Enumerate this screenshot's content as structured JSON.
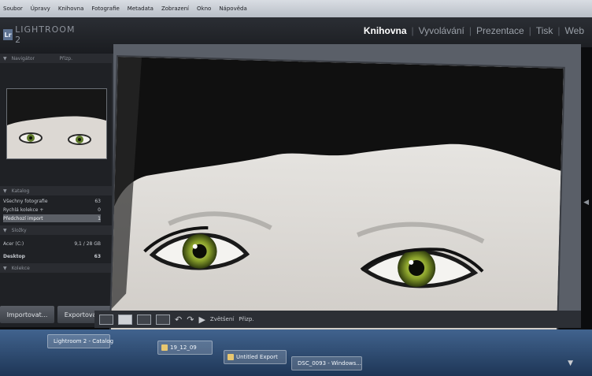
{
  "os_menu": [
    "Soubor",
    "Úpravy",
    "Knihovna",
    "Fotografie",
    "Metadata",
    "Zobrazení",
    "Okno",
    "Nápověda"
  ],
  "app": {
    "logo_abbrev": "Lr",
    "logo_name": "LIGHTROOM 2"
  },
  "modules": {
    "items": [
      {
        "label": "Knihovna",
        "active": true
      },
      {
        "label": "Vyvolávání",
        "active": false
      },
      {
        "label": "Prezentace",
        "active": false
      },
      {
        "label": "Tisk",
        "active": false
      },
      {
        "label": "Web",
        "active": false
      }
    ],
    "separator": "|"
  },
  "navigator": {
    "title": "Navigátor",
    "fit_label": "Přizp."
  },
  "catalog": {
    "title": "Katalog",
    "rows": [
      {
        "label": "Všechny fotografie",
        "count": "63",
        "selected": false
      },
      {
        "label": "Rychlá kolekce +",
        "count": "0",
        "selected": false
      },
      {
        "label": "Předchozí import",
        "count": "1",
        "selected": true
      }
    ]
  },
  "folders": {
    "title": "Složky",
    "drive": {
      "label": "Acer (C:)",
      "info": "9,1 / 28 GB"
    },
    "desktop": {
      "label": "Desktop",
      "count": "63"
    }
  },
  "collections": {
    "title": "Kolekce"
  },
  "buttons": {
    "import": "Importovat...",
    "export": "Exportovat..."
  },
  "toolbar": {
    "zoom_label": "Zvětšení",
    "fit_label": "Přizp."
  },
  "taskbar": {
    "items": [
      {
        "label": "Lightroom 2 - Catalog",
        "color": "#6d8fbd"
      },
      {
        "label": "19_12_09",
        "color": "#e8c770"
      },
      {
        "label": "Untitled Export",
        "color": "#e8c770"
      },
      {
        "label": "DSC_0093 - Windows...",
        "color": "#e26b3a"
      }
    ]
  },
  "colors": {
    "accent": "#ffffff",
    "panel": "#1f2125",
    "viewer_bg": "#5a5f68",
    "taskbar": "#2f4d75"
  }
}
